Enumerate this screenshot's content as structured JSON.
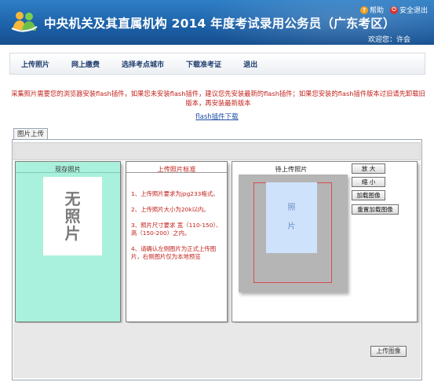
{
  "header": {
    "title": "中央机关及其直属机构 2014 年度考试录用公务员（广东考区）",
    "help_label": "帮助",
    "logout_label": "安全退出",
    "welcome": "欢迎您：许会"
  },
  "nav": {
    "items": [
      "上传照片",
      "网上缴费",
      "选择考点城市",
      "下载准考证",
      "退出"
    ]
  },
  "notice": {
    "text": "采集照片需要您的浏览器安装flash插件，如果您未安装flash插件，建议您先安装最新的flash插件；如果您安装的flash插件版本过旧请先卸载旧版本，再安装最新版本",
    "flash_link": "flash插件下载"
  },
  "upload": {
    "tab_label": "图片上传",
    "current_title": "现存照片",
    "no_photo_chars": [
      "无",
      "照",
      "片"
    ],
    "standard_title": "上传照片标准",
    "rules": [
      "1、上传照片要求为jpg233格式。",
      "2、上传照片大小为20k以内。",
      "3、照片尺寸要求 宽（110-150）、高（150-200）之内。",
      "4、请确认左侧图片为正式上传图片，右侧图片仅为本地预览"
    ],
    "pending_title": "待上传照片",
    "preview_chars": [
      "照",
      "片"
    ],
    "buttons": {
      "zoom_in": "放 大",
      "zoom_out": "缩 小",
      "load": "加载图像",
      "reload": "重置加载图像",
      "upload": "上传图像"
    }
  },
  "colors": {
    "header_blue": "#1d62a9",
    "notice_red": "#c0201a",
    "current_bg": "#a9f1dc",
    "preview_bg": "#cfe2fb"
  }
}
